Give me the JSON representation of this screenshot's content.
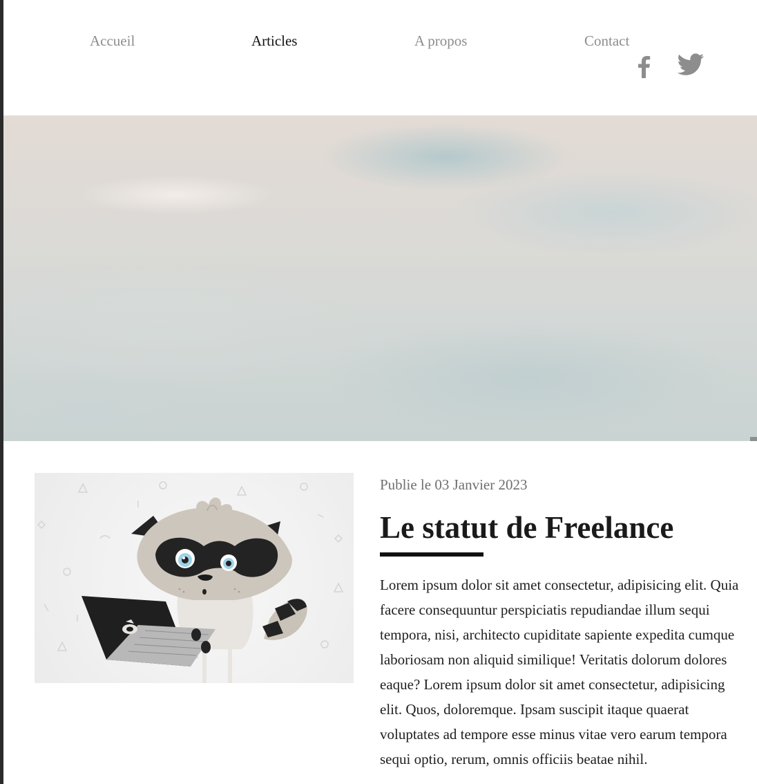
{
  "nav": {
    "items": [
      {
        "label": "Accueil"
      },
      {
        "label": "Articles"
      },
      {
        "label": "A propos"
      },
      {
        "label": "Contact"
      }
    ],
    "active": "Articles"
  },
  "social": {
    "facebook_icon": "facebook-icon",
    "twitter_icon": "twitter-icon",
    "color": "#8d8d8d"
  },
  "hero": {
    "image": "cloudy-sky"
  },
  "article": {
    "image": "raccoon-with-laptop-illustration",
    "date": "Publie le 03 Janvier 2023",
    "title": "Le statut de Freelance",
    "body": "Lorem ipsum dolor sit amet consectetur, adipisicing elit. Quia facere consequuntur perspiciatis repudiandae illum sequi tempora, nisi, architecto cupiditate sapiente expedita cumque laboriosam non aliquid similique! Veritatis dolorum dolores eaque? Lorem ipsum dolor sit amet consectetur, adipisicing elit. Quos, doloremque. Ipsam suscipit itaque quaerat voluptates ad tempore esse minus vitae vero earum tempora sequi optio, rerum, omnis officiis beatae nihil."
  }
}
